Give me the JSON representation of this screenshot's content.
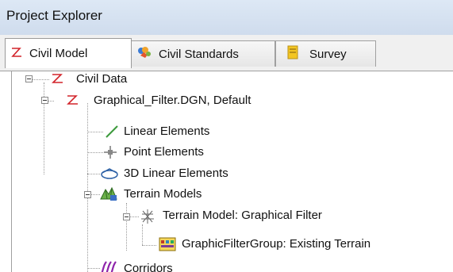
{
  "window": {
    "title": "Project Explorer"
  },
  "tabs": [
    {
      "label": "Civil Model",
      "icon": "civil-z-icon"
    },
    {
      "label": "Civil Standards",
      "icon": "standards-icon"
    },
    {
      "label": "Survey",
      "icon": "survey-icon"
    }
  ],
  "tree": {
    "items": [
      {
        "label": "Civil Data",
        "icon": "civil-z-icon"
      },
      {
        "label": "Graphical_Filter.DGN, Default",
        "icon": "civil-z-icon"
      },
      {
        "label": "Linear Elements",
        "icon": "line-icon"
      },
      {
        "label": "Point Elements",
        "icon": "point-icon"
      },
      {
        "label": "3D Linear Elements",
        "icon": "3d-linear-icon"
      },
      {
        "label": "Terrain Models",
        "icon": "terrain-models-icon"
      },
      {
        "label": "Terrain Model: Graphical Filter",
        "icon": "terrain-model-icon"
      },
      {
        "label": "GraphicFilterGroup: Existing Terrain",
        "icon": "filter-group-icon"
      },
      {
        "label": "Corridors",
        "icon": "corridors-icon"
      }
    ]
  },
  "colors": {
    "civil_red": "#d2232a",
    "line_green": "#3c9a3c",
    "title_bg": "#d6e2f1"
  }
}
